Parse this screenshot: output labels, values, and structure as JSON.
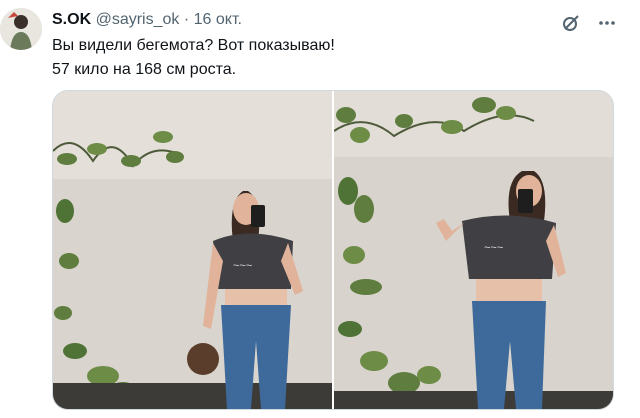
{
  "tweet": {
    "author_name": "S.OK",
    "handle": "@sayris_ok",
    "separator": "·",
    "date": "16 окт.",
    "text_line1": "Вы видели бегемота? Вот показываю!",
    "text_line2": "57 кило на 168 см роста."
  },
  "icons": {
    "grok": "slash-circle-icon",
    "more": "more-horizontal-icon"
  },
  "media": {
    "photos": [
      {
        "name": "mirror-selfie-photo-1"
      },
      {
        "name": "mirror-selfie-photo-2"
      }
    ]
  },
  "colors": {
    "text": "#0f1419",
    "muted": "#536471",
    "border": "#cfd9de"
  }
}
